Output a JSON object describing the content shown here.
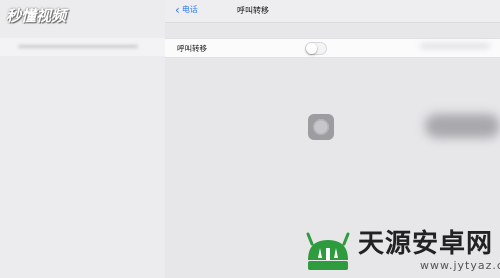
{
  "watermark": {
    "brand_text": "秒懂视频"
  },
  "navbar": {
    "back_label": "电话",
    "title": "呼叫转移"
  },
  "settings": {
    "row_label": "呼叫转移",
    "toggle_on": false
  },
  "logo": {
    "main_text": "天源安卓网",
    "url": "www.jytyaz.com"
  },
  "icons": {
    "back": "chevron-left-icon",
    "assistive": "assistive-touch-icon",
    "logo": "android-icon"
  },
  "colors": {
    "accent": "#2d7cf6",
    "logo_green": "#2e9b3f"
  }
}
